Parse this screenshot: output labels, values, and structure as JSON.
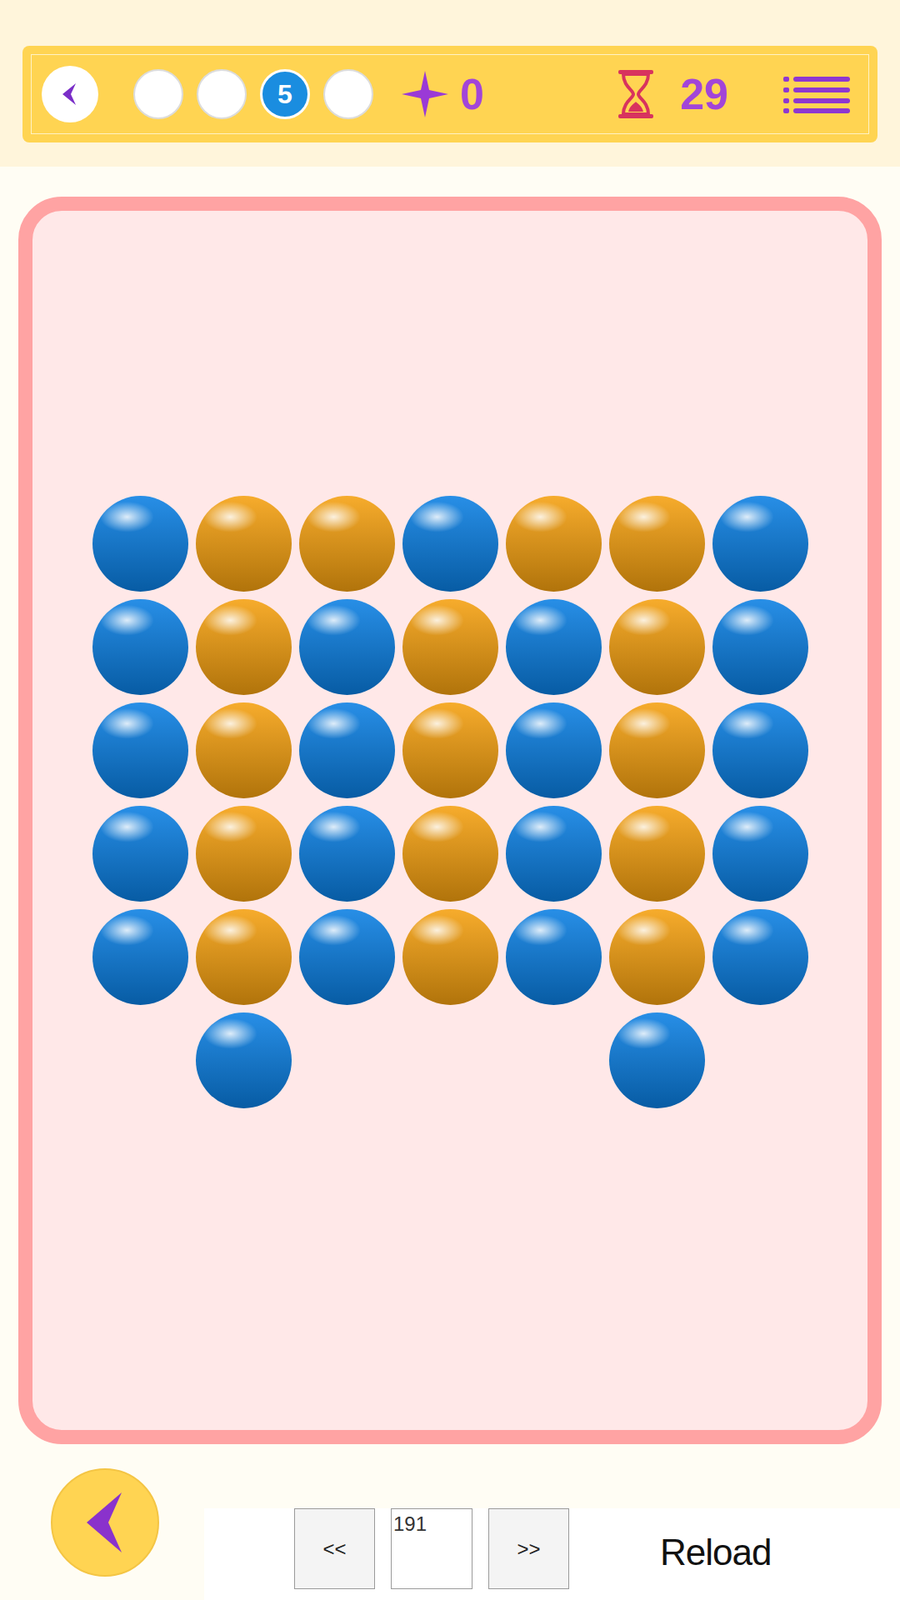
{
  "header": {
    "steps": [
      {
        "label": "",
        "selected": false
      },
      {
        "label": "",
        "selected": false
      },
      {
        "label": "5",
        "selected": true
      },
      {
        "label": "",
        "selected": false
      }
    ],
    "score": "0",
    "timer": "29"
  },
  "board": {
    "rows": [
      [
        {
          "color": "#0a7fe3"
        },
        {
          "color": "#f5a00f"
        },
        {
          "color": "#f5a00f"
        },
        {
          "color": "#0a7fe3"
        },
        {
          "color": "#f5a00f"
        },
        {
          "color": "#f5a00f"
        },
        {
          "color": "#0a7fe3"
        }
      ],
      [
        {
          "color": "#0a7fe3"
        },
        {
          "color": "#f5a00f"
        },
        {
          "color": "#0a7fe3"
        },
        {
          "color": "#f5a00f"
        },
        {
          "color": "#0a7fe3"
        },
        {
          "color": "#f5a00f"
        },
        {
          "color": "#0a7fe3"
        }
      ],
      [
        {
          "color": "#0a7fe3"
        },
        {
          "color": "#f5a00f"
        },
        {
          "color": "#0a7fe3"
        },
        {
          "color": "#f5a00f"
        },
        {
          "color": "#0a7fe3"
        },
        {
          "color": "#f5a00f"
        },
        {
          "color": "#0a7fe3"
        }
      ],
      [
        {
          "color": "#0a7fe3"
        },
        {
          "color": "#f5a00f"
        },
        {
          "color": "#0a7fe3"
        },
        {
          "color": "#f5a00f"
        },
        {
          "color": "#0a7fe3"
        },
        {
          "color": "#f5a00f"
        },
        {
          "color": "#0a7fe3"
        }
      ],
      [
        {
          "color": "#0a7fe3"
        },
        {
          "color": "#f5a00f"
        },
        {
          "color": "#0a7fe3"
        },
        {
          "color": "#f5a00f"
        },
        {
          "color": "#0a7fe3"
        },
        {
          "color": "#f5a00f"
        },
        {
          "color": "#0a7fe3"
        }
      ],
      [
        null,
        {
          "color": "#0a7fe3"
        },
        null,
        null,
        null,
        {
          "color": "#0a7fe3"
        },
        null
      ]
    ]
  },
  "footer": {
    "prev": "<<",
    "level": "191",
    "next": ">>",
    "reload": "Reload"
  }
}
